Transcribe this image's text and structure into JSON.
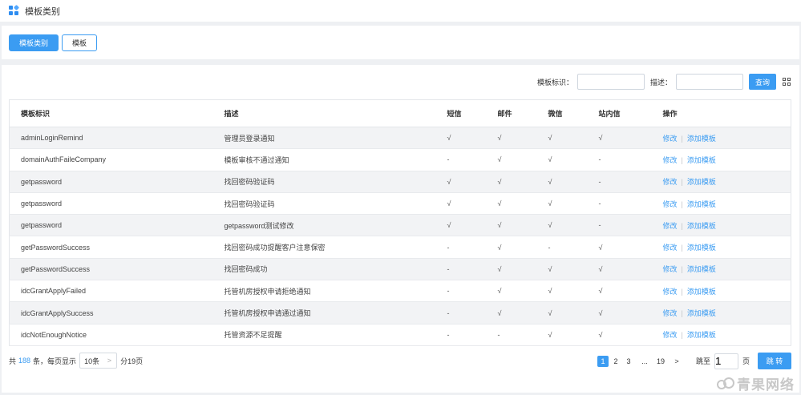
{
  "header": {
    "title": "模板类别",
    "icon": "grid-logo-icon"
  },
  "tabs": [
    {
      "label": "模板类别",
      "active": true
    },
    {
      "label": "模板",
      "active": false
    }
  ],
  "filter": {
    "id_label": "模板标识：",
    "desc_label": "描述：",
    "id_value": "",
    "desc_value": "",
    "query_label": "查询"
  },
  "table": {
    "columns": [
      "模板标识",
      "描述",
      "短信",
      "邮件",
      "微信",
      "站内信",
      "操作"
    ],
    "rows": [
      {
        "id": "adminLoginRemind",
        "desc": "管理员登录通知",
        "sms": "√",
        "email": "√",
        "wechat": "√",
        "site": "√"
      },
      {
        "id": "domainAuthFaileCompany",
        "desc": "模板审核不通过通知",
        "sms": "-",
        "email": "√",
        "wechat": "√",
        "site": "-"
      },
      {
        "id": "getpassword",
        "desc": "找回密码验证码",
        "sms": "√",
        "email": "√",
        "wechat": "√",
        "site": "-"
      },
      {
        "id": "getpassword",
        "desc": "找回密码验证码",
        "sms": "√",
        "email": "√",
        "wechat": "√",
        "site": "-"
      },
      {
        "id": "getpassword",
        "desc": "getpassword测试修改",
        "sms": "√",
        "email": "√",
        "wechat": "√",
        "site": "-"
      },
      {
        "id": "getPasswordSuccess",
        "desc": "找回密码成功提醒客户注意保密",
        "sms": "-",
        "email": "√",
        "wechat": "-",
        "site": "√"
      },
      {
        "id": "getPasswordSuccess",
        "desc": "找回密码成功",
        "sms": "-",
        "email": "√",
        "wechat": "√",
        "site": "√"
      },
      {
        "id": "idcGrantApplyFailed",
        "desc": "托管机房授权申请拒绝通知",
        "sms": "-",
        "email": "√",
        "wechat": "√",
        "site": "√"
      },
      {
        "id": "idcGrantApplySuccess",
        "desc": "托管机房授权申请通过通知",
        "sms": "-",
        "email": "√",
        "wechat": "√",
        "site": "√"
      },
      {
        "id": "idcNotEnoughNotice",
        "desc": "托管资源不足提醒",
        "sms": "-",
        "email": "-",
        "wechat": "√",
        "site": "√"
      }
    ],
    "op_edit": "修改",
    "op_sep": "|",
    "op_add": "添加模板"
  },
  "pagination": {
    "total_prefix": "共",
    "total": "188",
    "total_suffix": "条，每页显示",
    "page_size": "10条",
    "page_size_arrow": ">",
    "pages_text": "分19页",
    "pages": [
      "1",
      "2",
      "3",
      "...",
      "19",
      ">"
    ],
    "current": "1",
    "jump_label": "跳至",
    "jump_value": "1",
    "page_unit": "页",
    "go_label": "跳 转"
  },
  "watermark": "青果网络",
  "colors": {
    "accent": "#3b9cf2",
    "stripe": "#f2f3f5"
  }
}
